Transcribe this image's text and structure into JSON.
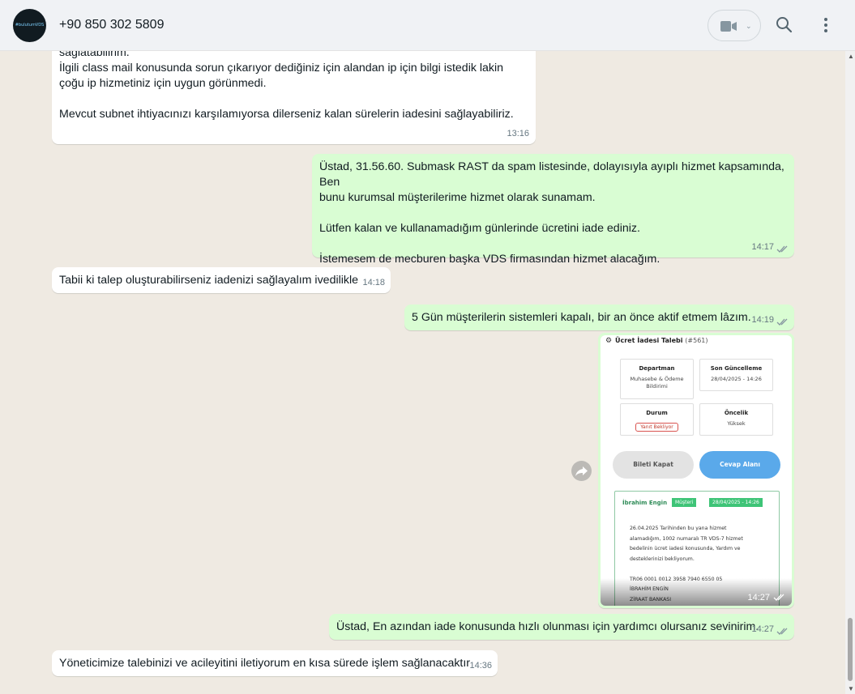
{
  "header": {
    "avatar_text": "#bulutumVDS",
    "contact": "+90 850 302 5809",
    "icons": {
      "video": "video-call-icon",
      "dropdown": "chevron-down-icon",
      "search": "search-icon",
      "menu": "menu-dots-icon"
    }
  },
  "messages": [
    {
      "direction": "in",
      "text": "sağlatabilirim.\nİlgili class mail konusunda sorun çıkarıyor dediğiniz için alandan ip için bilgi istedik lakin\nçoğu ip hizmetiniz için uygun görünmedi.\n\nMevcut subnet ihtiyacınızı karşılamıyorsa dilerseniz kalan sürelerin iadesini sağlayabiliriz.",
      "time": "13:16"
    },
    {
      "direction": "out",
      "text": "Üstad, 31.56.60. Submask RAST da spam listesinde, dolayısıyla ayıplı hizmet kapsamında, Ben\nbunu kurumsal müşterilerime hizmet olarak sunamam.\n\nLütfen kalan ve kullanamadığım günlerinde ücretini iade ediniz.\n\nİstemesem de mecburen başka VDS firmasından hizmet alacağım.",
      "time": "14:17"
    },
    {
      "direction": "in",
      "text": "Tabii ki talep oluşturabilirseniz iadenizi sağlayalım ivedilikle",
      "time": "14:18"
    },
    {
      "direction": "out",
      "text": "5 Gün müşterilerin sistemleri kapalı, bir an önce aktif etmem lâzım.",
      "time": "14:19"
    },
    {
      "direction": "out",
      "text": "Üstad, En azından iade konusunda hızlı olunması için yardımcı olursanız sevinirim.",
      "time": "14:27"
    },
    {
      "direction": "in",
      "text": "Yöneticimize talebinizi ve acileyitini iletiyorum en kısa sürede işlem sağlanacaktır",
      "time": "14:36"
    }
  ],
  "image_message": {
    "time": "14:27",
    "ticket": {
      "title": "Ücret İadesi Talebi",
      "number": "(#561)",
      "dept_label": "Departman",
      "dept_value": "Muhasebe & Ödeme\nBildirimi",
      "updated_label": "Son Güncelleme",
      "updated_value": "28/04/2025 - 14:26",
      "status_label": "Durum",
      "status_value": "Yanıt Bekliyor",
      "priority_label": "Öncelik",
      "priority_value": "Yüksek",
      "close_button": "Bileti Kapat",
      "reply_button": "Cevap Alanı",
      "reply_author": "İbrahim Engin",
      "reply_role": "Müşteri",
      "reply_date": "28/04/2025 - 14:26",
      "reply_body": "26.04.2025 Tarihinden bu yana hizmet\nalamadığım, 1002 numaralı TR VDS-7 hizmet\nbedelinin ücret iadesi konusunda, Yardım ve\ndesteklerinizi bekliyorum.\n\nTR06 0001 0012 3958 7940 6550 05\nİBRAHİM ENGİN\nZİRAAT BANKASI"
    }
  },
  "colors": {
    "chat_bg": "#efeae2",
    "incoming": "#ffffff",
    "outgoing": "#d9fdd3",
    "read_ticks": "#8696a0"
  }
}
